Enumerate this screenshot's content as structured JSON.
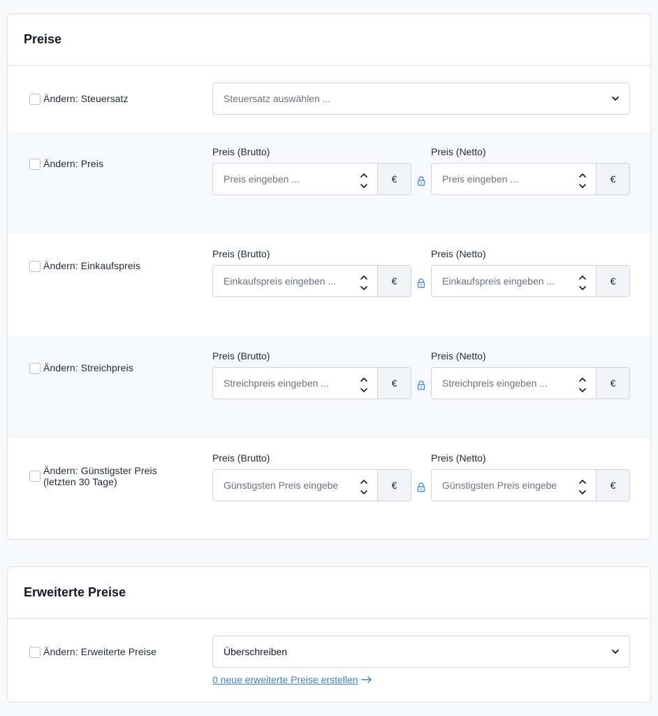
{
  "preise": {
    "title": "Preise",
    "steuersatz": {
      "checkbox_label": "Ändern: Steuersatz",
      "select_placeholder": "Steuersatz auswählen ..."
    },
    "price_rows": [
      {
        "checkbox_label": "Ändern: Preis",
        "brutto_label": "Preis (Brutto)",
        "netto_label": "Preis (Netto)",
        "brutto_placeholder": "Preis eingeben ...",
        "netto_placeholder": "Preis eingeben ...",
        "currency": "€"
      },
      {
        "checkbox_label": "Ändern: Einkaufspreis",
        "brutto_label": "Preis (Brutto)",
        "netto_label": "Preis (Netto)",
        "brutto_placeholder": "Einkaufspreis eingeben ...",
        "netto_placeholder": "Einkaufspreis eingeben ...",
        "currency": "€"
      },
      {
        "checkbox_label": "Ändern: Streichpreis",
        "brutto_label": "Preis (Brutto)",
        "netto_label": "Preis (Netto)",
        "brutto_placeholder": "Streichpreis eingeben ...",
        "netto_placeholder": "Streichpreis eingeben ...",
        "currency": "€"
      },
      {
        "checkbox_label": "Ändern: Günstigster Preis (letzten 30 Tage)",
        "brutto_label": "Preis (Brutto)",
        "netto_label": "Preis (Netto)",
        "brutto_placeholder": "Günstigsten Preis eingeben ...",
        "netto_placeholder": "Günstigsten Preis eingeben ...",
        "currency": "€"
      }
    ]
  },
  "erweiterte_preise": {
    "title": "Erweiterte Preise",
    "checkbox_label": "Ändern: Erweiterte Preise",
    "select_value": "Überschreiben",
    "create_link": "0 neue erweiterte Preise erstellen"
  },
  "colors": {
    "link": "#3b82c4",
    "lock": "#4a90d9",
    "shaded_row": "#f6f8fb"
  }
}
